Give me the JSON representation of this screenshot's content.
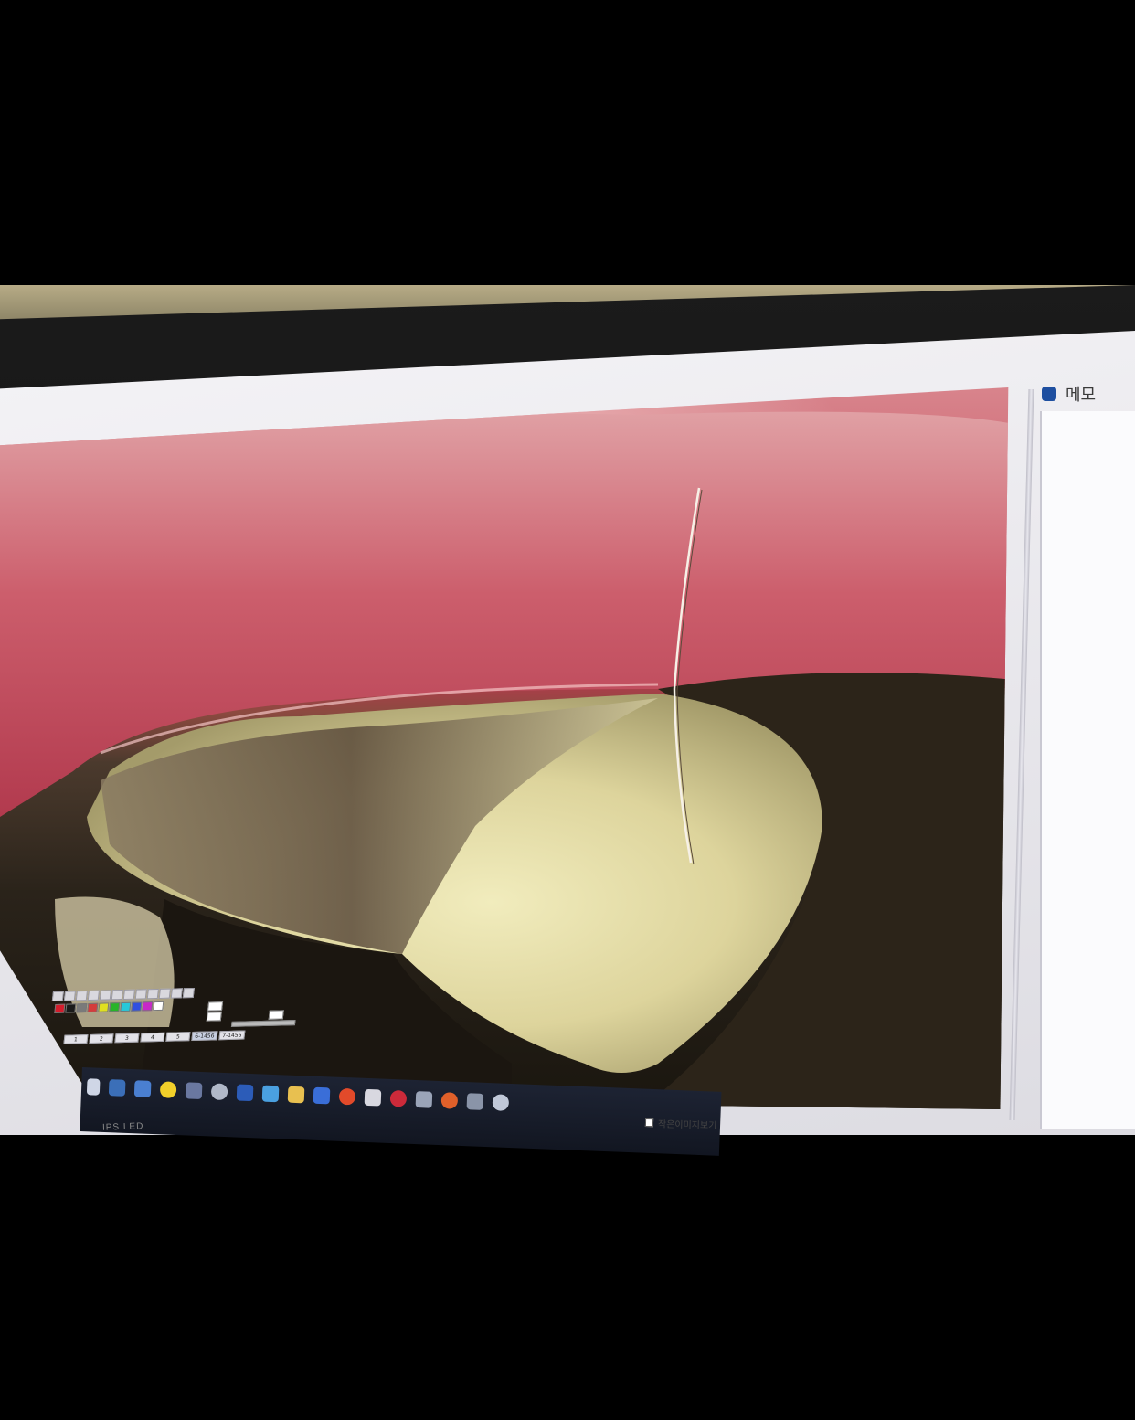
{
  "memo": {
    "title": "메모"
  },
  "toolbar": {
    "colors": [
      "#d41c2c",
      "#1a1a1a",
      "#7a7a7a",
      "#d43c3c",
      "#e0e020",
      "#28b428",
      "#28c8d8",
      "#3050e0",
      "#c828c8",
      "#ffffff"
    ],
    "page_buttons": [
      "1",
      "2",
      "3",
      "4",
      "5",
      "6-1456",
      "7-1456"
    ]
  },
  "taskbar": {
    "thumbnail_option_label": "작은이미지보기"
  }
}
